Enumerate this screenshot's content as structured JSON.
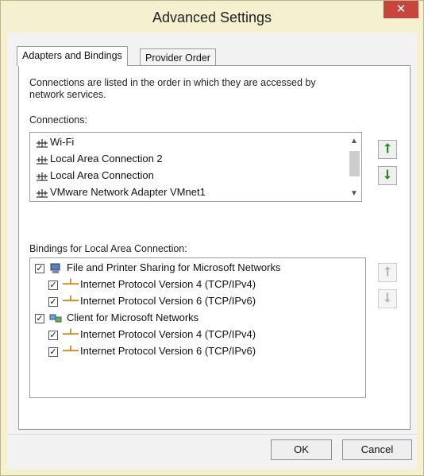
{
  "window": {
    "title": "Advanced Settings",
    "close_glyph": "✕"
  },
  "tabs": [
    {
      "label": "Adapters and Bindings",
      "active": true
    },
    {
      "label": "Provider Order",
      "active": false
    }
  ],
  "description": "Connections are listed in the order in which they are accessed by network services.",
  "description_line1": "Connections are listed in the order in which they are accessed by",
  "description_line2": "network services.",
  "connections_label": "Connections:",
  "connections": [
    {
      "label": "Wi-Fi",
      "icon": "network-adapter-icon"
    },
    {
      "label": "Local Area Connection 2",
      "icon": "network-adapter-icon"
    },
    {
      "label": "Local Area Connection",
      "icon": "network-adapter-icon"
    },
    {
      "label": "VMware Network Adapter VMnet1",
      "icon": "network-adapter-icon"
    }
  ],
  "bindings_label": "Bindings for Local Area Connection:",
  "bindings": [
    {
      "label": "File and Printer Sharing for Microsoft Networks",
      "checked": true,
      "level": 0,
      "icon": "file-printer-sharing-icon"
    },
    {
      "label": "Internet Protocol Version 4 (TCP/IPv4)",
      "checked": true,
      "level": 1,
      "icon": "protocol-icon"
    },
    {
      "label": "Internet Protocol Version 6 (TCP/IPv6)",
      "checked": true,
      "level": 1,
      "icon": "protocol-icon"
    },
    {
      "label": "Client for Microsoft Networks",
      "checked": true,
      "level": 0,
      "icon": "network-client-icon"
    },
    {
      "label": "Internet Protocol Version 4 (TCP/IPv4)",
      "checked": true,
      "level": 1,
      "icon": "protocol-icon"
    },
    {
      "label": "Internet Protocol Version 6 (TCP/IPv6)",
      "checked": true,
      "level": 1,
      "icon": "protocol-icon"
    }
  ],
  "buttons": {
    "ok": "OK",
    "cancel": "Cancel"
  },
  "glyphs": {
    "up": "⭡",
    "down": "⭣",
    "scroll_up": "▲",
    "scroll_down": "▼",
    "check": "✓"
  },
  "colors": {
    "accent_green": "#1e8a1e",
    "close_red": "#c8453d",
    "title_bg": "#f5f0cf"
  }
}
